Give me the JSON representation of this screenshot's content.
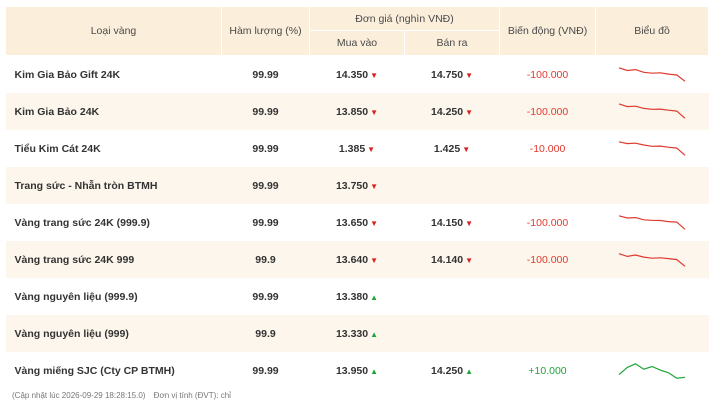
{
  "headers": {
    "type": "Loại vàng",
    "purity": "Hàm lượng (%)",
    "price_group": "Đơn giá (nghìn VNĐ)",
    "buy": "Mua vào",
    "sell": "Bán ra",
    "change": "Biến động (VNĐ)",
    "chart": "Biểu đồ"
  },
  "rows": [
    {
      "name": "Kim Gia Bảo Gift 24K",
      "purity": "99.99",
      "buy": "14.350",
      "buy_dir": "down",
      "sell": "14.750",
      "sell_dir": "down",
      "change": "-100.000",
      "trend": "down",
      "spark": [
        0.9,
        0.75,
        0.8,
        0.65,
        0.6,
        0.62,
        0.55,
        0.5,
        0.15
      ]
    },
    {
      "name": "Kim Gia Bảo 24K",
      "purity": "99.99",
      "buy": "13.850",
      "buy_dir": "down",
      "sell": "14.250",
      "sell_dir": "down",
      "change": "-100.000",
      "trend": "down",
      "spark": [
        0.95,
        0.8,
        0.82,
        0.7,
        0.65,
        0.66,
        0.6,
        0.55,
        0.15
      ]
    },
    {
      "name": "Tiểu Kim Cát 24K",
      "purity": "99.99",
      "buy": "1.385",
      "buy_dir": "down",
      "sell": "1.425",
      "sell_dir": "down",
      "change": "-10.000",
      "trend": "down",
      "spark": [
        0.9,
        0.8,
        0.82,
        0.72,
        0.65,
        0.66,
        0.6,
        0.55,
        0.15
      ]
    },
    {
      "name": "Trang sức - Nhẫn tròn BTMH",
      "purity": "99.99",
      "buy": "13.750",
      "buy_dir": "down",
      "sell": "",
      "sell_dir": "",
      "change": "",
      "trend": "",
      "spark": []
    },
    {
      "name": "Vàng trang sức 24K (999.9)",
      "purity": "99.99",
      "buy": "13.650",
      "buy_dir": "down",
      "sell": "14.150",
      "sell_dir": "down",
      "change": "-100.000",
      "trend": "down",
      "spark": [
        0.9,
        0.78,
        0.8,
        0.68,
        0.65,
        0.64,
        0.58,
        0.55,
        0.15
      ]
    },
    {
      "name": "Vàng trang sức 24K 999",
      "purity": "99.9",
      "buy": "13.640",
      "buy_dir": "down",
      "sell": "14.140",
      "sell_dir": "down",
      "change": "-100.000",
      "trend": "down",
      "spark": [
        0.85,
        0.7,
        0.78,
        0.66,
        0.6,
        0.62,
        0.58,
        0.52,
        0.15
      ]
    },
    {
      "name": "Vàng nguyên liệu (999.9)",
      "purity": "99.99",
      "buy": "13.380",
      "buy_dir": "up",
      "sell": "",
      "sell_dir": "",
      "change": "",
      "trend": "",
      "spark": []
    },
    {
      "name": "Vàng nguyên liệu (999)",
      "purity": "99.9",
      "buy": "13.330",
      "buy_dir": "up",
      "sell": "",
      "sell_dir": "",
      "change": "",
      "trend": "",
      "spark": []
    },
    {
      "name": "Vàng miếng SJC (Cty CP BTMH)",
      "purity": "99.99",
      "buy": "13.950",
      "buy_dir": "up",
      "sell": "14.250",
      "sell_dir": "up",
      "change": "+10.000",
      "trend": "up",
      "spark": [
        0.3,
        0.7,
        0.9,
        0.6,
        0.75,
        0.55,
        0.4,
        0.1,
        0.15
      ]
    }
  ],
  "footer": {
    "updated": "(Cập nhật lúc 2026-09-29 18:28:15.0)",
    "unit": "Đơn vị tính (ĐVT): chỉ"
  },
  "colors": {
    "down": "#e03a2e",
    "up": "#1fa33a",
    "header_bg": "#fbeedb",
    "stripe_bg": "#fdf6ec"
  },
  "icons": {
    "down": "triangle-down-icon",
    "up": "triangle-up-icon"
  }
}
